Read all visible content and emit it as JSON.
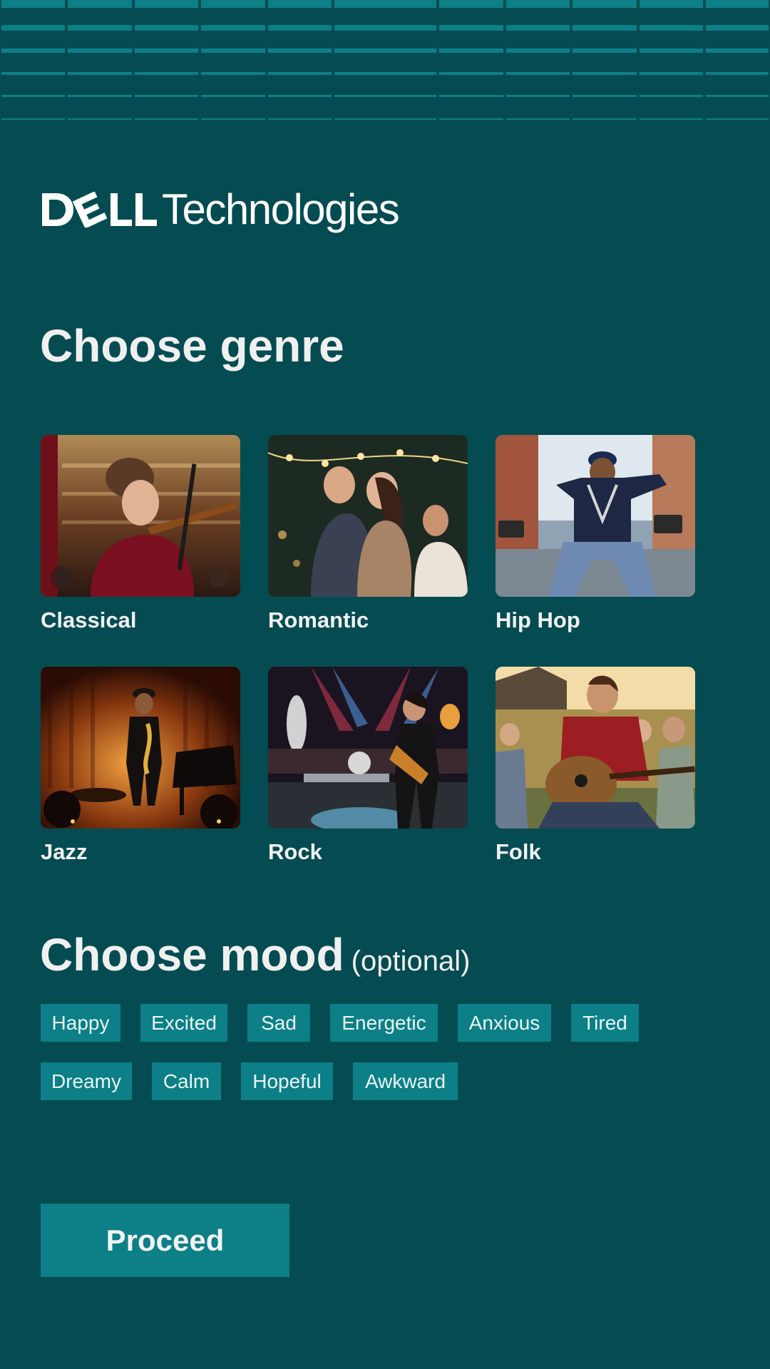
{
  "brand": {
    "logo_text_dell": "DELL",
    "logo_text_tech": "Technologies"
  },
  "genre_section": {
    "title": "Choose genre",
    "genres": [
      {
        "label": "Classical",
        "icon": "violinist-photo"
      },
      {
        "label": "Romantic",
        "icon": "dancing-couple-photo"
      },
      {
        "label": "Hip Hop",
        "icon": "hip-hop-dancer-photo"
      },
      {
        "label": "Jazz",
        "icon": "saxophonist-photo"
      },
      {
        "label": "Rock",
        "icon": "rock-guitarist-photo"
      },
      {
        "label": "Folk",
        "icon": "acoustic-guitarist-photo"
      }
    ]
  },
  "mood_section": {
    "title": "Choose mood",
    "optional_note": "(optional)",
    "moods": [
      "Happy",
      "Excited",
      "Sad",
      "Energetic",
      "Anxious",
      "Tired",
      "Dreamy",
      "Calm",
      "Hopeful",
      "Awkward"
    ]
  },
  "proceed_label": "Proceed",
  "colors": {
    "background": "#044c52",
    "accent": "#0c7f87",
    "text": "#f0f0f0"
  }
}
